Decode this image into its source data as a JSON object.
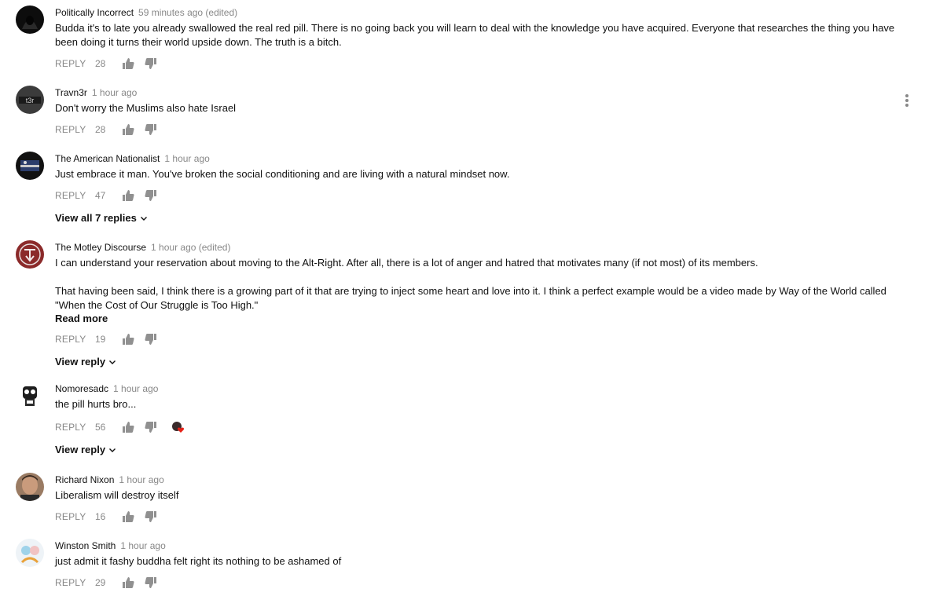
{
  "comments": [
    {
      "author": "Politically Incorrect",
      "time": "59 minutes ago (edited)",
      "paragraphs": [
        "Budda it's to late you already swallowed the real red pill. There is no going back you will learn to deal with the knowledge you have acquired. Everyone that researches the thing you have been doing it turns their world upside down. The truth is a bitch."
      ],
      "reply_label": "REPLY",
      "likes": "28"
    },
    {
      "author": "Travn3r",
      "time": "1 hour ago",
      "paragraphs": [
        "Don't worry the Muslims also hate Israel"
      ],
      "reply_label": "REPLY",
      "likes": "28"
    },
    {
      "author": "The American Nationalist",
      "time": "1 hour ago",
      "paragraphs": [
        "Just embrace it man.  You've broken the social conditioning and are living with a natural mindset now."
      ],
      "reply_label": "REPLY",
      "likes": "47",
      "view_replies": "View all 7 replies"
    },
    {
      "author": "The Motley Discourse",
      "time": "1 hour ago (edited)",
      "paragraphs": [
        "I can understand your reservation about moving to the Alt-Right. After all, there is a lot of anger and hatred that motivates many (if not most) of its members.",
        "That having been said, I think there is a growing part of it that are trying to inject some heart and love into it. I think a perfect example would be a video made by Way of the World called \"When the Cost of Our Struggle is Too High.\""
      ],
      "read_more": "Read more",
      "reply_label": "REPLY",
      "likes": "19",
      "view_replies": "View reply"
    },
    {
      "author": "Nomoresadc",
      "time": "1 hour ago",
      "paragraphs": [
        "the pill hurts bro..."
      ],
      "reply_label": "REPLY",
      "likes": "56",
      "view_replies": "View reply"
    },
    {
      "author": "Richard Nixon",
      "time": "1 hour ago",
      "paragraphs": [
        "Liberalism will destroy itself"
      ],
      "reply_label": "REPLY",
      "likes": "16"
    },
    {
      "author": "Winston Smith",
      "time": "1 hour ago",
      "paragraphs": [
        "just admit it fashy buddha felt right its nothing to be ashamed of"
      ],
      "reply_label": "REPLY",
      "likes": "29"
    }
  ],
  "icons": {
    "like": "thumb-up-icon",
    "dislike": "thumb-down-icon",
    "expand": "chevron-down-icon",
    "menu": "more-vert-icon",
    "creator_heart": "creator-heart-icon"
  },
  "colors": {
    "text": "#111111",
    "meta": "#888888",
    "heart": "#e62117"
  }
}
